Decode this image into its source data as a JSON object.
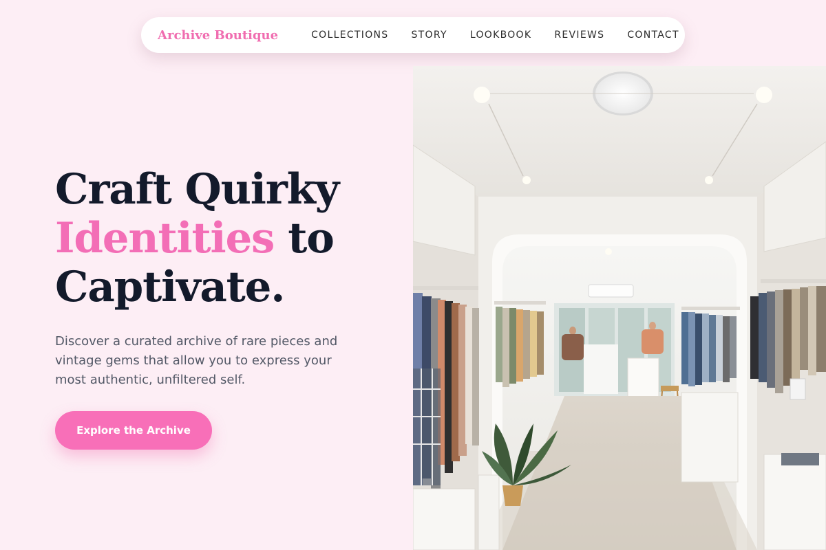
{
  "nav": {
    "brand": "Archive Boutique",
    "links": [
      "COLLECTIONS",
      "STORY",
      "LOOKBOOK",
      "REVIEWS",
      "CONTACT"
    ]
  },
  "hero": {
    "line1": "Craft Quirky",
    "line2_accent": "Identities",
    "line2_rest": " to",
    "line3": "Captivate.",
    "description": "Discover a curated archive of rare pieces and vintage gems that allow you to express your most authentic, unfiltered self.",
    "cta_label": "Explore the Archive"
  },
  "colors": {
    "background": "#fdeef5",
    "accent": "#f36eb6",
    "heading": "#131a2b",
    "button": "#f86fb8"
  },
  "image": {
    "subject": "boutique-interior-photo"
  }
}
